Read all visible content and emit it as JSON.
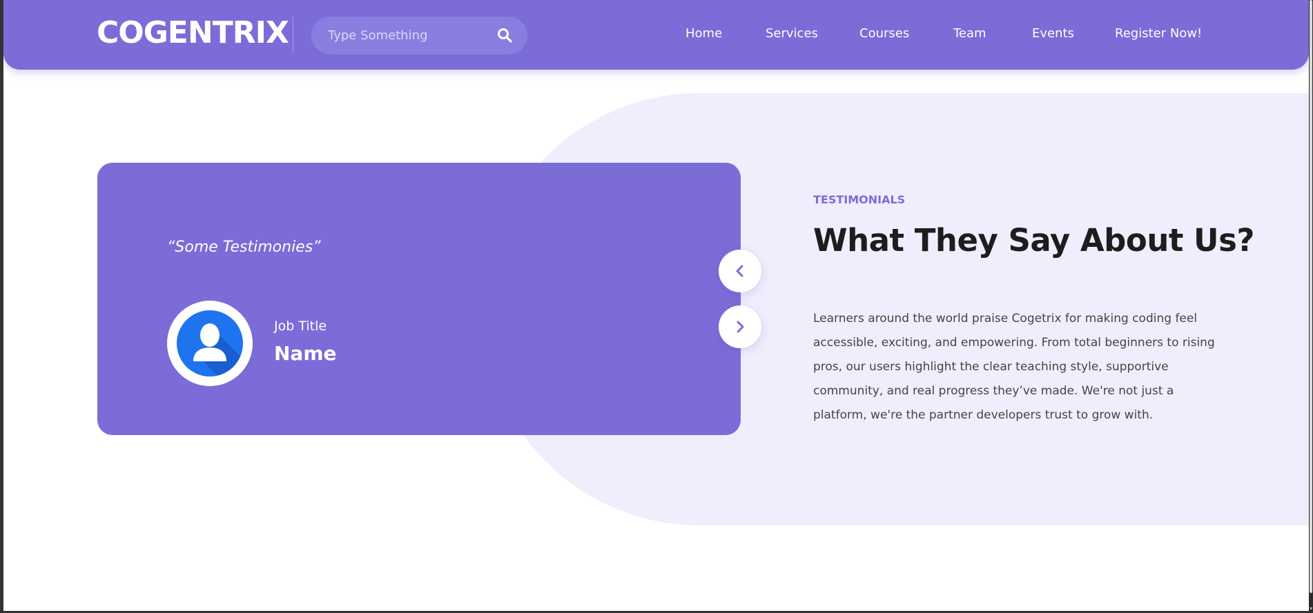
{
  "header": {
    "logo": "COGENTRIX",
    "search": {
      "placeholder": "Type Something",
      "value": ""
    },
    "nav": [
      "Home",
      "Services",
      "Courses",
      "Team",
      "Events",
      "Register Now!"
    ]
  },
  "testimonial": {
    "quote": "“Some Testimonies”",
    "job_title": "Job Title",
    "name": "Name"
  },
  "section": {
    "eyebrow": "TESTIMONIALS",
    "heading": "What They Say About Us?",
    "body": "Learners around the world praise Cogetrix for making coding feel accessible, exciting, and empowering. From total beginners to rising pros, our users highlight the clear teaching style, supportive community, and real progress they’ve made. We're not just a platform, we're the partner developers trust to grow with."
  },
  "colors": {
    "brand": "#7b6cd8",
    "blob": "#efeefc",
    "heading": "#1d1d1d",
    "avatar": "#1e74ee"
  },
  "icons": [
    "search-icon",
    "user-avatar-icon",
    "chevron-left-icon",
    "chevron-right-icon"
  ]
}
